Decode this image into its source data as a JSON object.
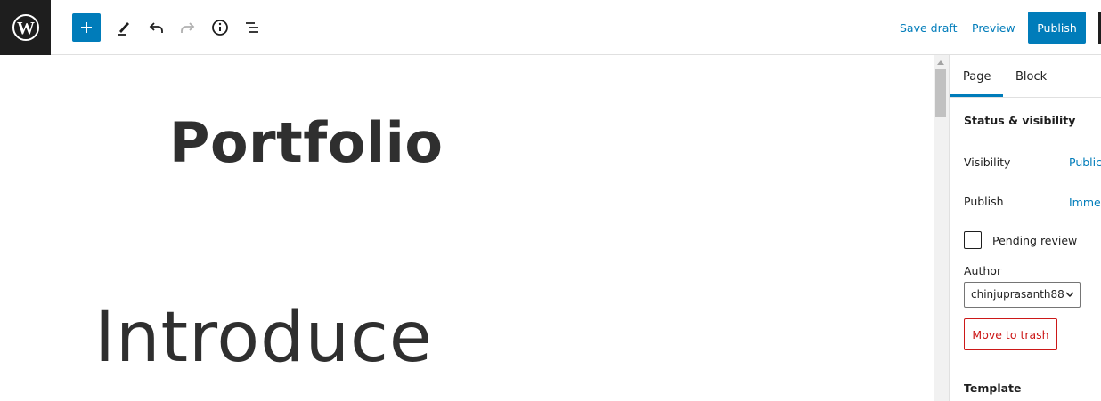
{
  "toolbar": {
    "logo_icon": "wordpress-logo-icon",
    "icons": [
      "plus-icon",
      "pencil-icon",
      "undo-icon",
      "redo-icon",
      "info-icon",
      "list-view-icon"
    ],
    "save_draft_label": "Save draft",
    "preview_label": "Preview",
    "publish_label": "Publish"
  },
  "editor": {
    "title": "Portfolio",
    "heading": "Introduce"
  },
  "sidebar": {
    "tabs": [
      {
        "label": "Page",
        "active": true
      },
      {
        "label": "Block",
        "active": false
      }
    ],
    "status_panel": {
      "title": "Status & visibility",
      "visibility_label": "Visibility",
      "visibility_value": "Public",
      "publish_label": "Publish",
      "publish_value": "Immediately",
      "pending_review_label": "Pending review",
      "pending_review_checked": false,
      "author_label": "Author",
      "author_value": "chinjuprasanth88",
      "trash_label": "Move to trash"
    },
    "template_panel": {
      "title": "Template"
    }
  },
  "colors": {
    "accent": "#007cba",
    "danger": "#cc1818",
    "logo_bg": "#1e1e1e"
  }
}
